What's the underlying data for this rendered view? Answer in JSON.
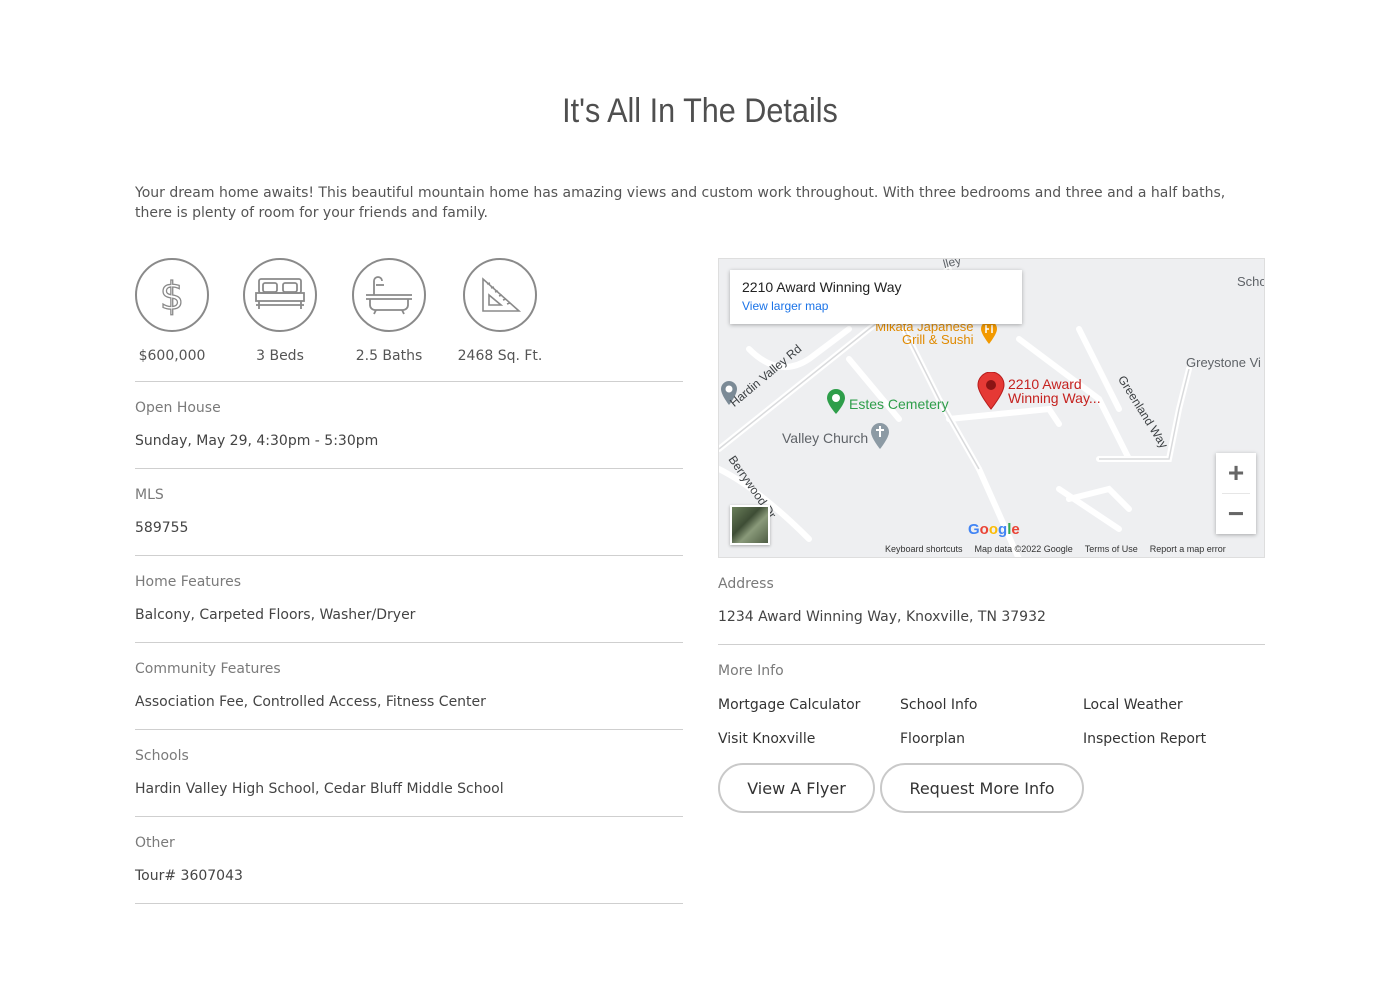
{
  "page": {
    "title": "It's All In The Details",
    "intro": "Your dream home awaits! This beautiful mountain home has amazing views and custom work throughout. With three bedrooms and three and a half baths, there is plenty of room for your friends and family."
  },
  "stats": [
    {
      "icon": "dollar-icon",
      "label": "$600,000"
    },
    {
      "icon": "bed-icon",
      "label": "3 Beds"
    },
    {
      "icon": "bathtub-icon",
      "label": "2.5 Baths"
    },
    {
      "icon": "ruler-triangle-icon",
      "label": "2468 Sq. Ft."
    }
  ],
  "details": [
    {
      "key": "Open House",
      "value": "Sunday, May 29, 4:30pm - 5:30pm"
    },
    {
      "key": "MLS",
      "value": "589755"
    },
    {
      "key": "Home Features",
      "value": "Balcony, Carpeted Floors, Washer/Dryer"
    },
    {
      "key": "Community Features",
      "value": "Association Fee, Controlled Access, Fitness Center"
    },
    {
      "key": "Schools",
      "value": "Hardin Valley High School, Cedar Bluff Middle School"
    },
    {
      "key": "Other",
      "value": "Tour# 3607043"
    }
  ],
  "map": {
    "card_address": "2210 Award Winning Way",
    "card_link": "View larger map",
    "labels": {
      "restaurant": "Mikata Japanese",
      "restaurant2": "Grill & Sushi",
      "pin": "2210 Award",
      "pin2": "Winning Way...",
      "cemetery": "Estes Cemetery",
      "church": "Valley Church",
      "hardin": "Hardin Valley Rd",
      "berrywood": "Berrywood Dr",
      "greenland": "Greenland Way",
      "greystone": "Greystone Vi",
      "school": "Scho",
      "valley_top": "lley"
    },
    "zoom_in": "+",
    "zoom_out": "−",
    "google": "Google",
    "attribution": [
      "Keyboard shortcuts",
      "Map data ©2022 Google",
      "Terms of Use",
      "Report a map error"
    ]
  },
  "address": {
    "key": "Address",
    "value": "1234 Award Winning Way, Knoxville, TN 37932"
  },
  "more_info": {
    "key": "More Info",
    "links": [
      "Mortgage Calculator",
      "School Info",
      "Local Weather",
      "Visit Knoxville",
      "Floorplan",
      "Inspection Report"
    ]
  },
  "buttons": {
    "flyer": "View A Flyer",
    "request": "Request More Info"
  },
  "colors": {
    "pin": "#e53935",
    "restaurant": "#e08a00",
    "cemetery": "#2e9e4a",
    "link": "#1a73e8"
  }
}
